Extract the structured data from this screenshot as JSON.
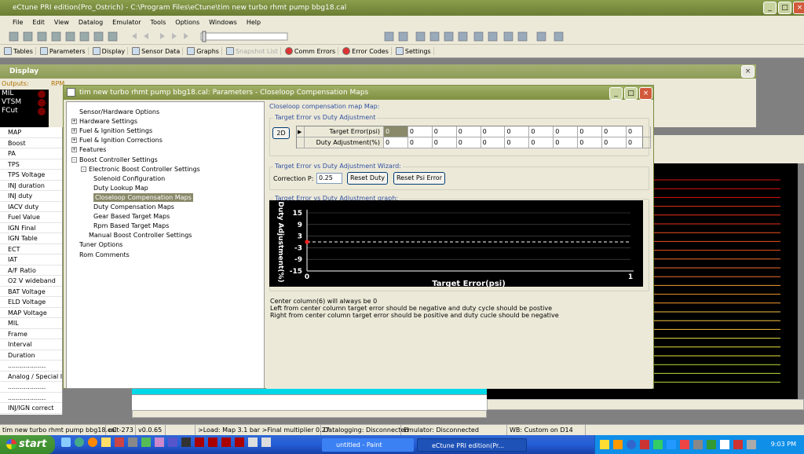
{
  "app": {
    "title": "eCtune PRI edition(Pro_Ostrich) - C:\\Program Files\\eCtune\\tim new turbo rhmt pump bbg18.cal"
  },
  "menu": [
    "File",
    "Edit",
    "View",
    "Datalog",
    "Emulator",
    "Tools",
    "Options",
    "Windows",
    "Help"
  ],
  "toolbar": [
    {
      "label": "Tables",
      "disabled": false
    },
    {
      "label": "Parameters",
      "disabled": false
    },
    {
      "label": "Display",
      "disabled": false
    },
    {
      "label": "Sensor Data",
      "disabled": false
    },
    {
      "label": "Graphs",
      "disabled": false
    },
    {
      "label": "Snapshot List",
      "disabled": true
    },
    {
      "label": "Comm Errors",
      "disabled": false
    },
    {
      "label": "Error Codes",
      "disabled": false
    },
    {
      "label": "Settings",
      "disabled": false
    }
  ],
  "display_window": {
    "title": "Display",
    "outputs_label": "Outputs:",
    "rpm_label": "RPM",
    "outputs": [
      "MIL",
      "VTSM",
      "FCut"
    ]
  },
  "sensor_list": [
    "MAP",
    "Boost",
    "PA",
    "TPS",
    "TPS Voltage",
    "INJ duration",
    "INJ duty",
    "IACV duty",
    "Fuel Value",
    "IGN Final",
    "IGN Table",
    "ECT",
    "IAT",
    "A/F Ratio",
    "O2 V wideband",
    "BAT Voltage",
    "ELD Voltage",
    "MAP Voltage",
    "MIL",
    "Frame",
    "Interval",
    "Duration",
    "...................",
    "Analog / Special Inp",
    "...................",
    "...................",
    "INJ/IGN correct"
  ],
  "dialog": {
    "title": "tim new turbo rhmt pump bbg18.cal: Parameters - Closeloop Compensation Maps",
    "tree": [
      {
        "label": "Sensor/Hardware Options",
        "level": 0,
        "expander": ""
      },
      {
        "label": "Hardware Settings",
        "level": 0,
        "expander": "+"
      },
      {
        "label": "Fuel & Ignition Settings",
        "level": 0,
        "expander": "+"
      },
      {
        "label": "Fuel & Ignition Corrections",
        "level": 0,
        "expander": "+"
      },
      {
        "label": "Features",
        "level": 0,
        "expander": "+"
      },
      {
        "label": "Boost Controller Settings",
        "level": 0,
        "expander": "-"
      },
      {
        "label": "Electronic Boost Controller Settings",
        "level": 1,
        "expander": "-"
      },
      {
        "label": "Solenoid Configuration",
        "level": 2,
        "expander": ""
      },
      {
        "label": "Duty Lookup Map",
        "level": 2,
        "expander": ""
      },
      {
        "label": "Closeloop Compensation Maps",
        "level": 2,
        "expander": "",
        "selected": true
      },
      {
        "label": "Duty Compensation Maps",
        "level": 2,
        "expander": ""
      },
      {
        "label": "Gear Based Target Maps",
        "level": 2,
        "expander": ""
      },
      {
        "label": "Rpm Based Target Maps",
        "level": 2,
        "expander": ""
      },
      {
        "label": "Manual Boost Controller Settings",
        "level": 1,
        "expander": ""
      },
      {
        "label": "Tuner Options",
        "level": 0,
        "expander": ""
      },
      {
        "label": "Rom Comments",
        "level": 0,
        "expander": ""
      }
    ],
    "panel_heading": "Closeloop compensation map Map:",
    "group1_title": "Target Error vs Duty Adjustment",
    "btn_2d": "2D",
    "row1_label": "Target Error(psi)",
    "row2_label": "Duty Adjustment(%)",
    "row1_values": [
      "0",
      "0",
      "0",
      "0",
      "0",
      "0",
      "0",
      "0",
      "0",
      "0",
      "0"
    ],
    "row2_values": [
      "0",
      "0",
      "0",
      "0",
      "0",
      "0",
      "0",
      "0",
      "0",
      "0",
      "0"
    ],
    "group2_title": "Target Error vs Duty Adjustment Wizard:",
    "correction_label": "Correction P:",
    "correction_value": "0.25",
    "btn_reset_duty": "Reset Duty",
    "btn_reset_psi": "Reset Psi Error",
    "group3_title": "Target Error vs Duty Adjustment graph:",
    "notes": [
      "Center column(6) will always be 0",
      "Left from center column target error should be negative and duty cycle should be postive",
      "Right from center column target error should be positive and duty cucle should be negative"
    ]
  },
  "chart_data": {
    "type": "line",
    "title": "",
    "xlabel": "Target Error(psi)",
    "ylabel": "Duty Adjustment(%)",
    "xlim": [
      0,
      1
    ],
    "ylim": [
      -15,
      15
    ],
    "x_ticks": [
      "0",
      "1"
    ],
    "y_ticks": [
      "15",
      "9",
      "3",
      "-3",
      "-9",
      "-15"
    ],
    "series": [
      {
        "x": [
          0,
          0,
          0,
          0,
          0,
          0,
          0,
          0,
          0,
          0,
          0
        ],
        "y": [
          0,
          0,
          0,
          0,
          0,
          0,
          0,
          0,
          0,
          0,
          0
        ]
      }
    ],
    "colors": {
      "background": "#000000",
      "line": "#ffffff",
      "point": "#ff2020",
      "text": "#ffffff"
    }
  },
  "status": [
    "tim new turbo rhmt pump bbg18.cal",
    "eCt-273",
    "v0.0.65",
    "",
    ">Load: Map 3.1 bar >Final multiplier 0.27",
    "Datalogging: Disconnected",
    "Emulator: Disconnected",
    "WB: Custom on D14"
  ],
  "taskbar": {
    "start": "start",
    "tasks": [
      "untitled - Paint",
      "eCtune PRI edition(Pr..."
    ],
    "clock": "9:03 PM"
  }
}
